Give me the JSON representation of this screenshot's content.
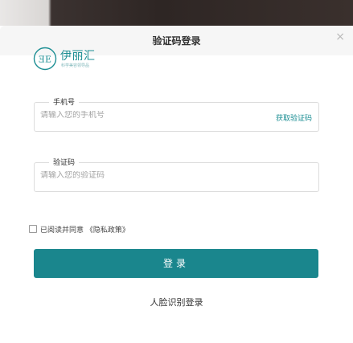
{
  "modal": {
    "title": "验证码登录",
    "close_icon": "×"
  },
  "brand": {
    "logo_mark": "ƎE",
    "name": "伊丽汇",
    "tagline": "科学美容领导品",
    "accent_color": "#1a868d"
  },
  "phone_field": {
    "label": "手机号",
    "placeholder": "请输入您的手机号",
    "sms_link": "获取验证码"
  },
  "code_field": {
    "label": "验证码",
    "placeholder": "请输入您的验证码"
  },
  "agreement": {
    "prefix": "已阅读并同意",
    "policy_link": "《隐私政策》",
    "checked": false
  },
  "login_button": "登录",
  "face_login": "人脸识别登录"
}
